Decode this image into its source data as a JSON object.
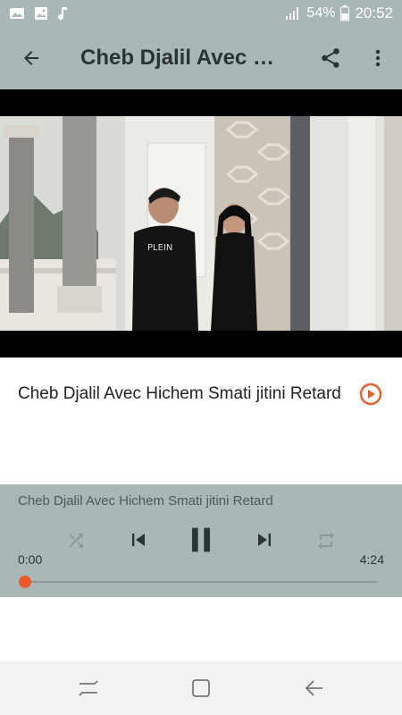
{
  "status_bar": {
    "battery": "54%",
    "time": "20:52",
    "icons": [
      "gallery-notification-icon",
      "image-notification-icon",
      "music-notification-icon",
      "signal-icon",
      "battery-icon"
    ]
  },
  "app_bar": {
    "title": "Cheb Djalil Avec Hichem Smati jitini Retard",
    "back_icon": "arrow-left-icon",
    "share_icon": "share-icon",
    "more_icon": "more-vert-icon"
  },
  "track": {
    "title": "Cheb Djalil Avec Hichem Smati jitini Retard",
    "play_icon": "play-circle-icon",
    "accent": "#e0602b"
  },
  "player": {
    "title": "Cheb Djalil Avec Hichem Smati jitini Retard",
    "current_time": "0:00",
    "duration": "4:24",
    "progress": 0,
    "controls": [
      "shuffle-icon",
      "skip-previous-icon",
      "pause-icon",
      "skip-next-icon",
      "repeat-icon"
    ]
  },
  "colors": {
    "bar": "#a9b7b7",
    "accent": "#ef5a2a"
  },
  "nav_bar": {
    "icons": [
      "recent-apps-icon",
      "home-icon",
      "back-icon"
    ]
  }
}
